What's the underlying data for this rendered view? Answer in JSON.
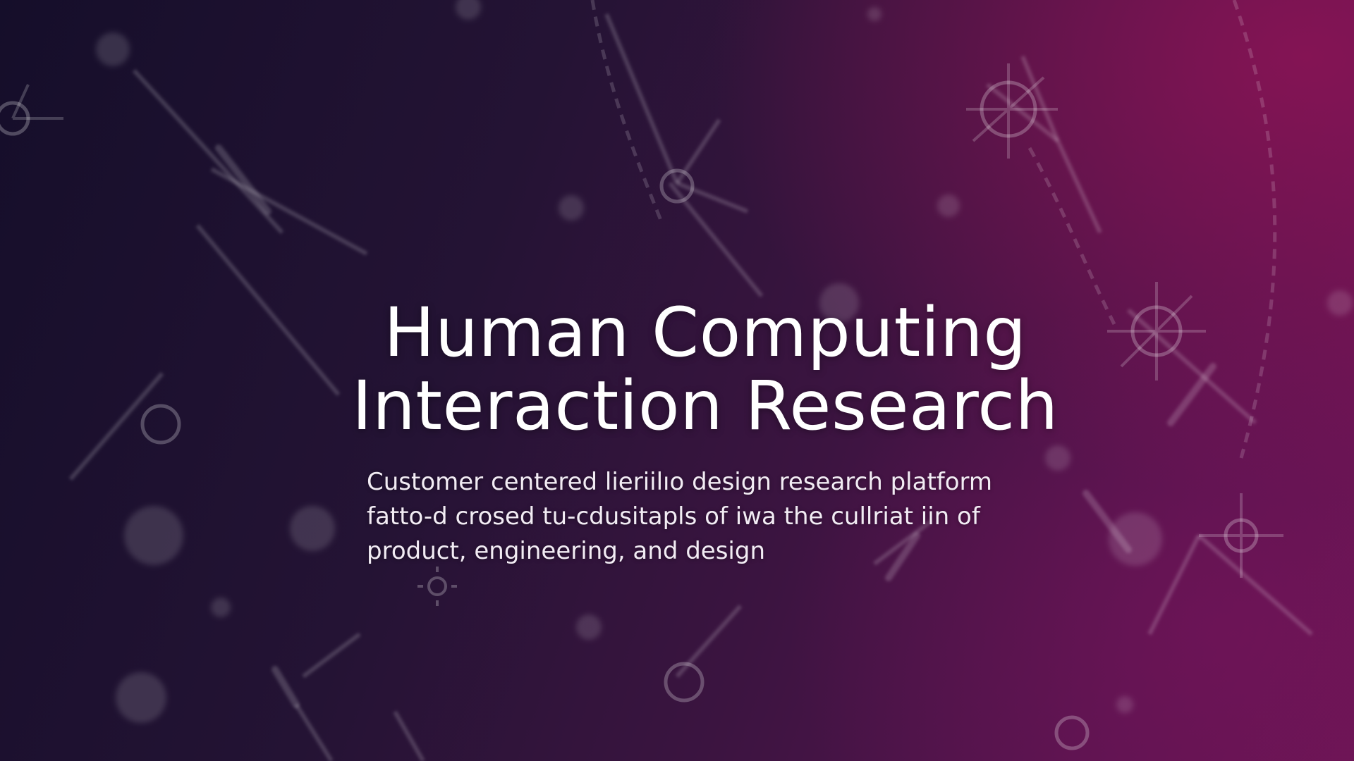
{
  "slide": {
    "title_lines": [
      "Human Computing",
      "Interaction Research"
    ],
    "subtitle_lines": [
      "Customer centered lieriilıo design research platform",
      "fatto-d crosed tu-cdusitapls of iwa the cullriat iin of",
      "product, engineering, and design"
    ]
  },
  "colors": {
    "background_dark": "#17102a",
    "background_accent": "#6a1554",
    "title_text": "#ffffff",
    "subtitle_text": "#f2ecf4"
  },
  "icons": [
    "molecule-network-icon",
    "node-hub-icon",
    "gear-icon",
    "tool-icon"
  ]
}
